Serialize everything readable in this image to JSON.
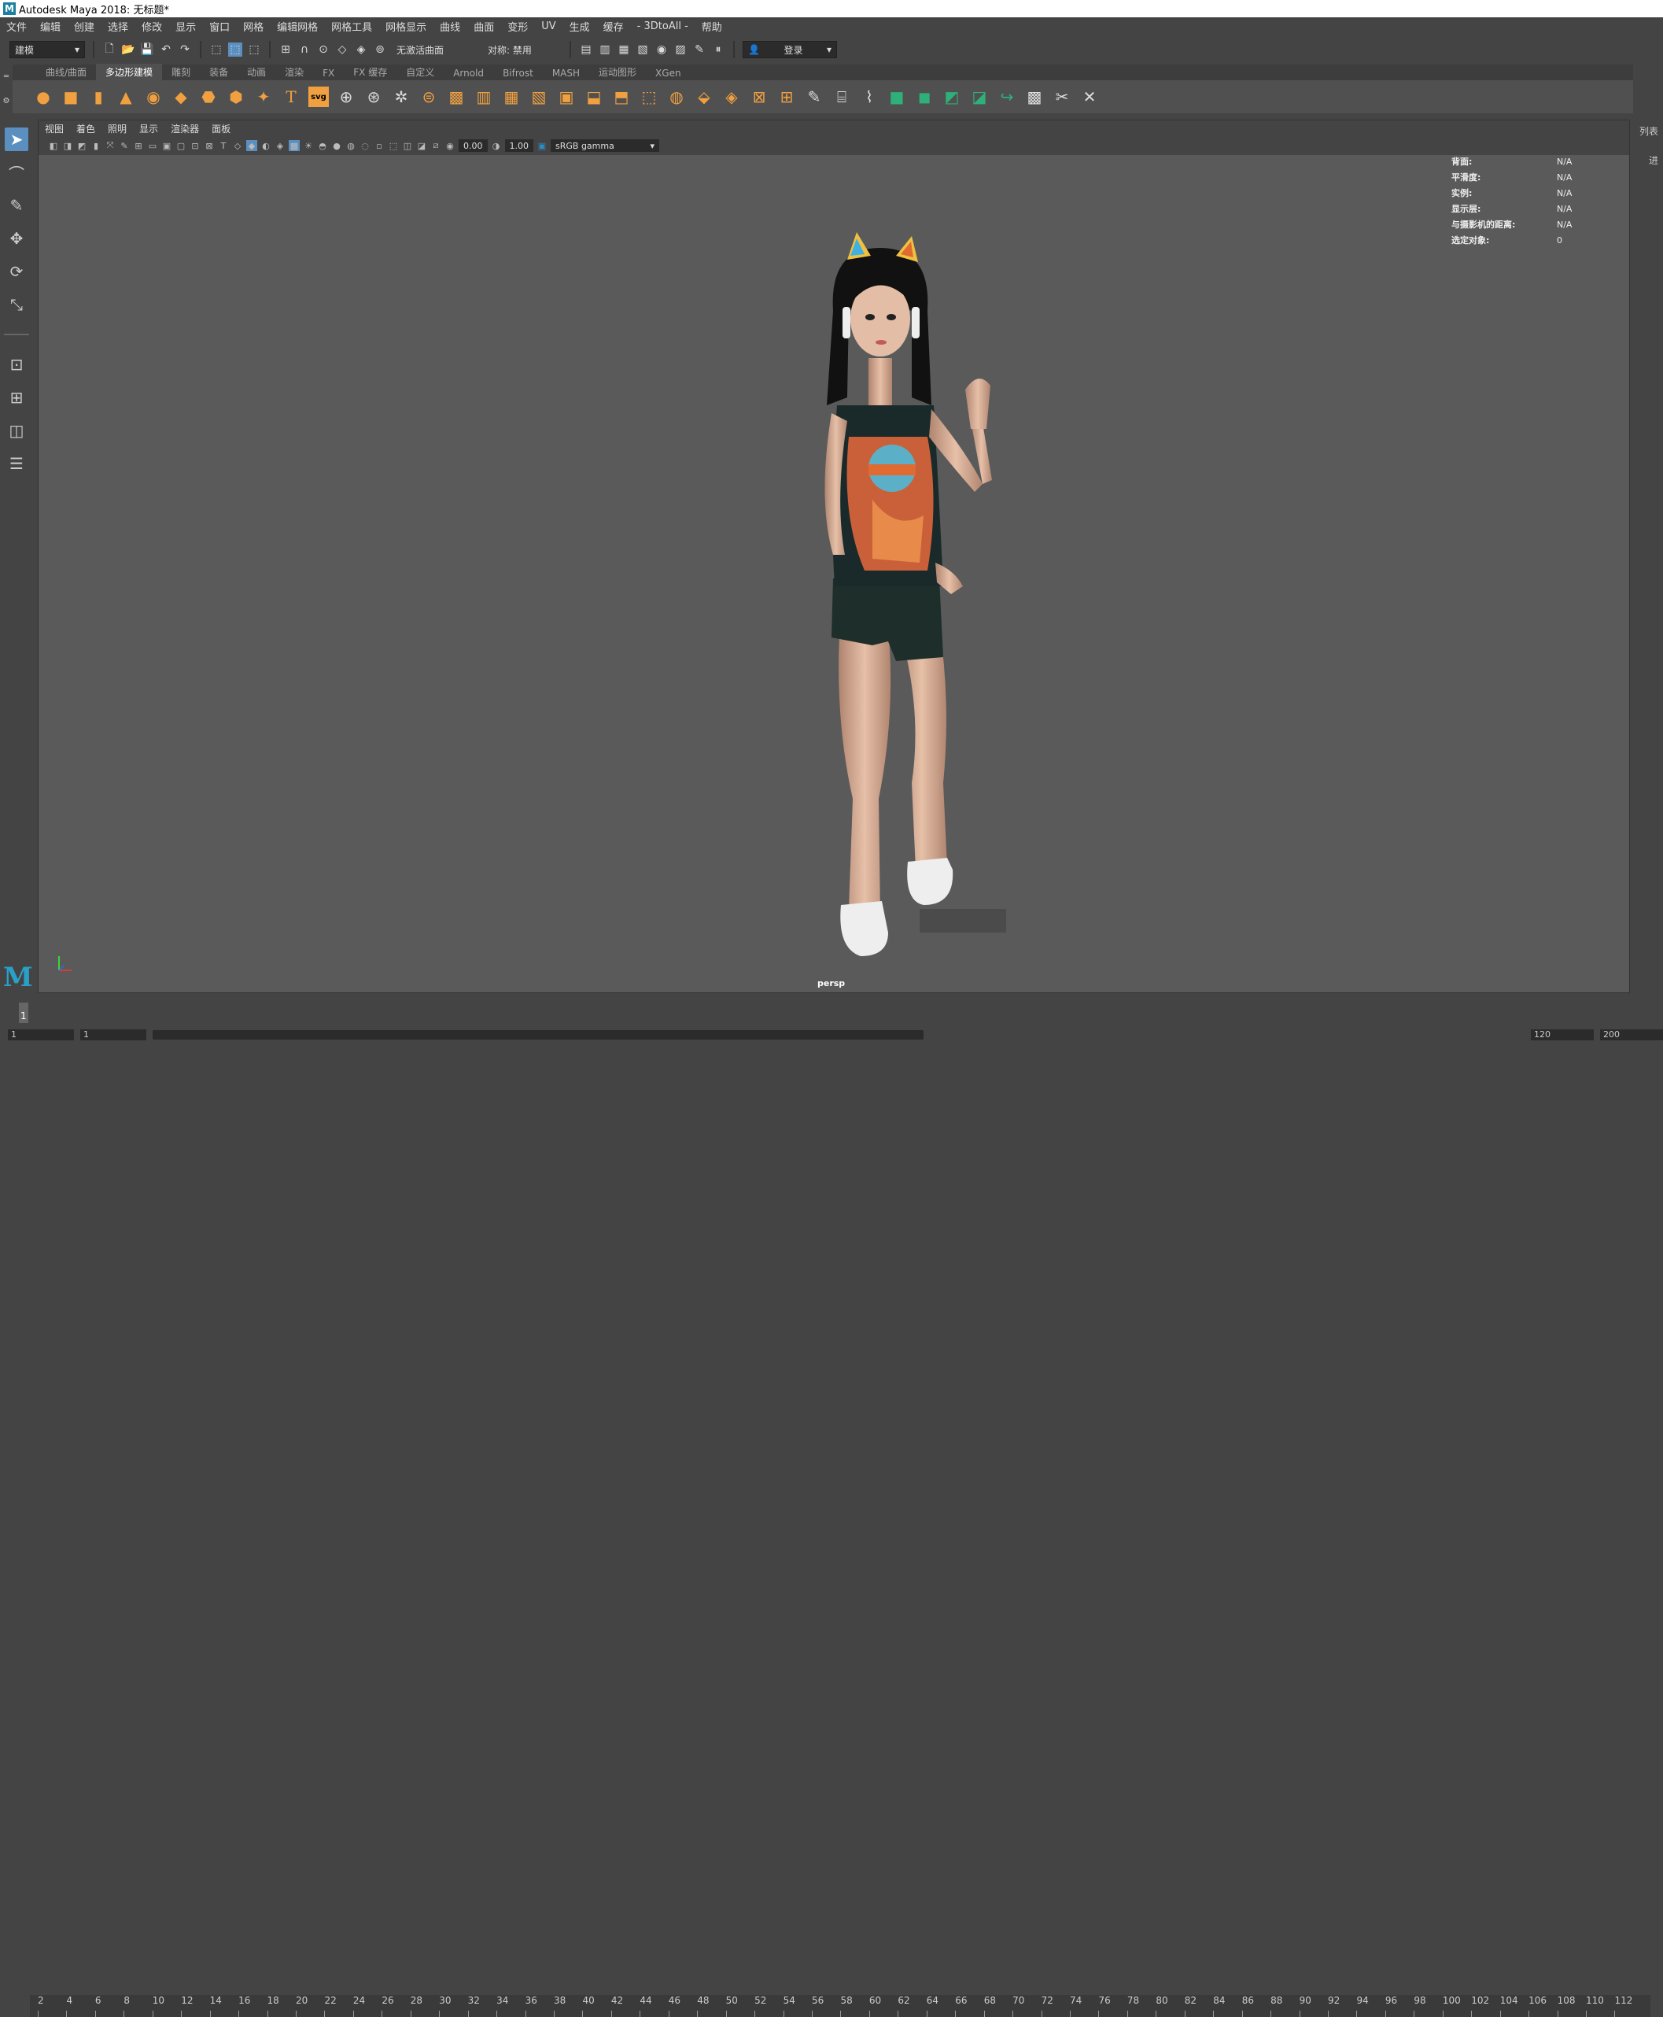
{
  "window": {
    "title": "Autodesk Maya 2018: 无标题*"
  },
  "menu": [
    "文件",
    "编辑",
    "创建",
    "选择",
    "修改",
    "显示",
    "窗口",
    "网格",
    "编辑网格",
    "网格工具",
    "网格显示",
    "曲线",
    "曲面",
    "变形",
    "UV",
    "生成",
    "缓存",
    "- 3DtoAll -",
    "帮助"
  ],
  "status_line": {
    "mode": "建模",
    "live_surface": "无激活曲面",
    "symmetry": "对称: 禁用",
    "login": "登录"
  },
  "shelf_tabs": [
    "曲线/曲面",
    "多边形建模",
    "雕刻",
    "装备",
    "动画",
    "渲染",
    "FX",
    "FX 缓存",
    "自定义",
    "Arnold",
    "Bifrost",
    "MASH",
    "运动图形",
    "XGen"
  ],
  "shelf_active": "多边形建模",
  "panel_menu": [
    "视图",
    "着色",
    "照明",
    "显示",
    "渲染器",
    "面板"
  ],
  "panel_tools": {
    "exposure": "0.00",
    "gamma": "1.00",
    "color_space": "sRGB gamma"
  },
  "hud": [
    {
      "k": "背面:",
      "v": "N/A"
    },
    {
      "k": "平滑度:",
      "v": "N/A"
    },
    {
      "k": "实例:",
      "v": "N/A"
    },
    {
      "k": "显示层:",
      "v": "N/A"
    },
    {
      "k": "与摄影机的距离:",
      "v": "N/A"
    },
    {
      "k": "选定对象:",
      "v": "0"
    }
  ],
  "camera_label": "persp",
  "right_strip": {
    "label_top": "列表",
    "label_mid": "进"
  },
  "timeline": {
    "ticks": [
      "2",
      "4",
      "6",
      "8",
      "10",
      "12",
      "14",
      "16",
      "18",
      "20",
      "22",
      "24",
      "26",
      "28",
      "30",
      "32",
      "34",
      "36",
      "38",
      "40",
      "42",
      "44",
      "46",
      "48",
      "50",
      "52",
      "54",
      "56",
      "58",
      "60",
      "62",
      "64",
      "66",
      "68",
      "70",
      "72",
      "74",
      "76",
      "78",
      "80",
      "82",
      "84",
      "86",
      "88",
      "90",
      "92",
      "94",
      "96",
      "98",
      "100",
      "102",
      "104",
      "106",
      "108",
      "110",
      "112"
    ],
    "current_frame": "1"
  },
  "range": {
    "start": "1",
    "start2": "1",
    "end": "120",
    "end2": "200"
  }
}
